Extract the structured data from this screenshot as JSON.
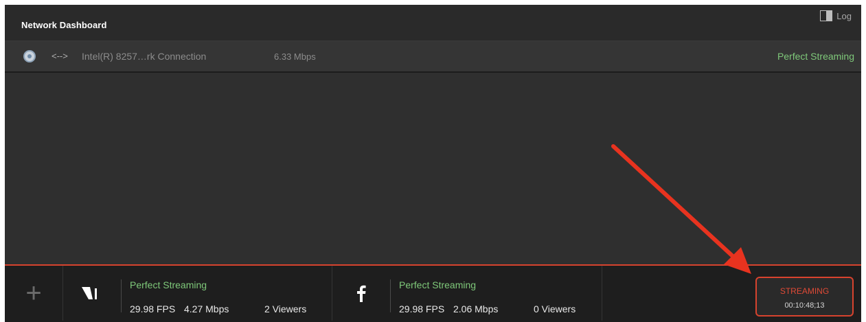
{
  "header": {
    "title": "Network Dashboard",
    "log_label": "Log"
  },
  "connection": {
    "arrows": "<-->",
    "name": "Intel(R) 8257…rk Connection",
    "speed": "6.33 Mbps",
    "status": "Perfect Streaming"
  },
  "destinations": [
    {
      "icon": "livestream-logo-icon",
      "status": "Perfect Streaming",
      "fps": "29.98 FPS",
      "mbps": "4.27 Mbps",
      "viewers": "2 Viewers"
    },
    {
      "icon": "facebook-icon",
      "status": "Perfect Streaming",
      "fps": "29.98 FPS",
      "mbps": "2.06 Mbps",
      "viewers": "0 Viewers"
    }
  ],
  "add_button": {
    "icon": "plus-icon"
  },
  "stream_button": {
    "label": "STREAMING",
    "time": "00:10:48;13"
  },
  "colors": {
    "status_green": "#7fc97a",
    "accent_red": "#d8432e",
    "background": "#2f2f2f"
  }
}
